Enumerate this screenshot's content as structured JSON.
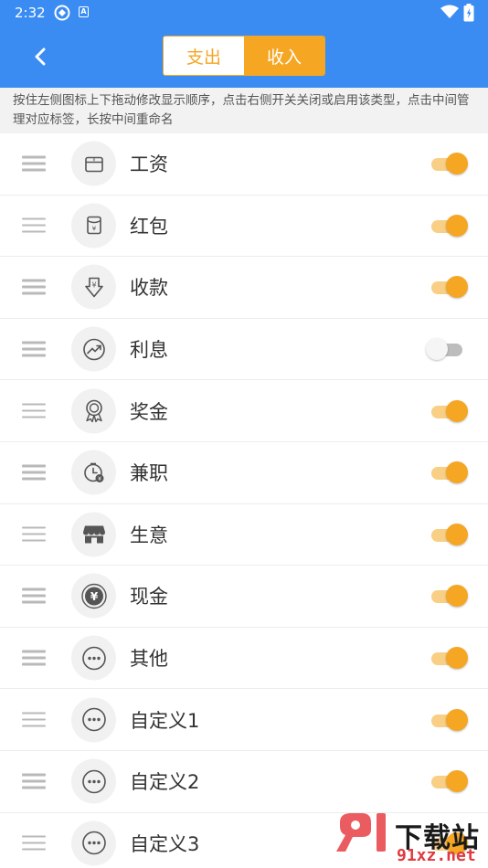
{
  "status": {
    "time": "2:32",
    "notif_letter": "A"
  },
  "header": {
    "tab_expense": "支出",
    "tab_income": "收入",
    "active_tab": "income"
  },
  "hint": "按住左侧图标上下拖动修改显示顺序，点击右侧开关关闭或启用该类型，点击中间管理对应标签，长按中间重命名",
  "items": [
    {
      "label": "工资",
      "icon": "wallet-icon",
      "enabled": true
    },
    {
      "label": "红包",
      "icon": "red-envelope-icon",
      "enabled": true
    },
    {
      "label": "收款",
      "icon": "receive-money-icon",
      "enabled": true
    },
    {
      "label": "利息",
      "icon": "trend-up-icon",
      "enabled": false
    },
    {
      "label": "奖金",
      "icon": "medal-icon",
      "enabled": true
    },
    {
      "label": "兼职",
      "icon": "clock-money-icon",
      "enabled": true
    },
    {
      "label": "生意",
      "icon": "shop-icon",
      "enabled": true
    },
    {
      "label": "现金",
      "icon": "cash-coin-icon",
      "enabled": true
    },
    {
      "label": "其他",
      "icon": "more-icon",
      "enabled": true
    },
    {
      "label": "自定义1",
      "icon": "more-icon",
      "enabled": true
    },
    {
      "label": "自定义2",
      "icon": "more-icon",
      "enabled": true
    },
    {
      "label": "自定义3",
      "icon": "more-icon",
      "enabled": true
    }
  ],
  "watermark": {
    "brand": "下载站",
    "site": "91xz.net"
  },
  "colors": {
    "header": "#3a8cf3",
    "accent": "#f5a623",
    "toggle_on_track": "#f8cf85",
    "toggle_off_track": "#bdbdbd"
  }
}
